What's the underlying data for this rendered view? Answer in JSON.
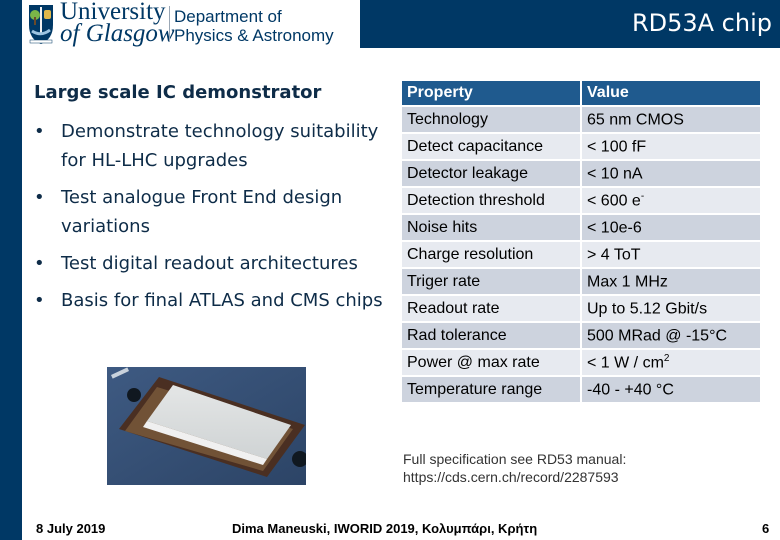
{
  "header": {
    "university_line1": "University",
    "university_line2": "of Glasgow",
    "department_line1": "Department of",
    "department_line2": "Physics & Astronomy",
    "slide_title": "RD53A chip"
  },
  "left": {
    "subtitle": "Large scale IC demonstrator",
    "bullet_glyph": "•",
    "bullets": [
      "Demonstrate technology suitability for HL-LHC upgrades",
      "Test analogue Front End design variations",
      "Test digital readout architectures",
      "Basis for final ATLAS and CMS chips"
    ],
    "photo": "rd53a-chip-photo"
  },
  "table": {
    "headers": [
      "Property",
      "Value"
    ],
    "rows": [
      {
        "property": "Technology",
        "value": "65 nm CMOS",
        "sup": ""
      },
      {
        "property": "Detect capacitance",
        "value": "< 100 fF",
        "sup": ""
      },
      {
        "property": "Detector leakage",
        "value": "< 10 nA",
        "sup": ""
      },
      {
        "property": "Detection threshold",
        "value": "< 600 e",
        "sup": "-"
      },
      {
        "property": "Noise hits",
        "value": "< 10e-6",
        "sup": ""
      },
      {
        "property": "Charge resolution",
        "value": "> 4 ToT",
        "sup": ""
      },
      {
        "property": "Triger rate",
        "value": "Max 1 MHz",
        "sup": ""
      },
      {
        "property": "Readout rate",
        "value": "Up to 5.12 Gbit/s",
        "sup": ""
      },
      {
        "property": "Rad tolerance",
        "value": "500 MRad @ -15°C",
        "sup": ""
      },
      {
        "property": "Power @ max rate",
        "value": "< 1 W / cm",
        "sup": "2"
      },
      {
        "property": "Temperature range",
        "value": "-40 - +40 °C",
        "sup": ""
      }
    ]
  },
  "note": {
    "line1": "Full specification see RD53 manual:",
    "line2": "https://cds.cern.ch/record/2287593"
  },
  "footer": {
    "date": "8 July 2019",
    "author": "Dima Maneuski, IWORID 2019, Κολυμπάρι, Κρήτη",
    "page": "6"
  },
  "colors": {
    "brand_navy": "#003865",
    "table_header": "#1f5a8e",
    "row_dark": "#cdd3de",
    "row_light": "#e7eaf0",
    "text_dark": "#0e2c48"
  }
}
